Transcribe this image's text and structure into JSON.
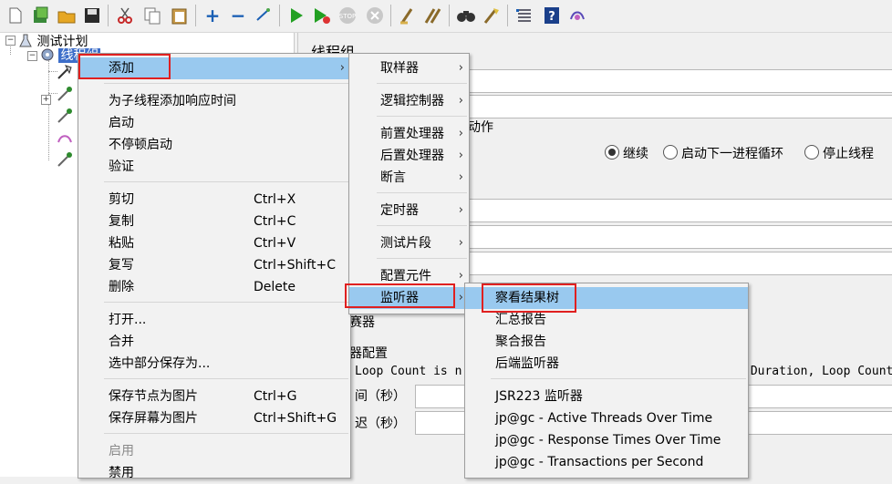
{
  "tree": {
    "root_label": "测试计划",
    "thread_group_label": "线程组"
  },
  "right_panel": {
    "title": "线程组",
    "action_label_fragment": "动作",
    "radio_continue": "继续",
    "radio_next_loop": "启动下一进程循环",
    "radio_stop_thread": "停止线程",
    "label_fragment_1": "赛器",
    "scheduler_fragment": "器配置",
    "loop_count_fragment": "Loop Count is n",
    "duration_fragment": "(Duration, Loop Count",
    "duration_label_fragment": "间（秒）",
    "delay_label_fragment": "迟（秒）"
  },
  "context_menu": {
    "items": [
      {
        "label": "添加",
        "shortcut": "",
        "submenu": true
      },
      {
        "label": "为子线程添加响应时间",
        "shortcut": ""
      },
      {
        "label": "启动",
        "shortcut": ""
      },
      {
        "label": "不停顿启动",
        "shortcut": ""
      },
      {
        "label": "验证",
        "shortcut": ""
      },
      {
        "label": "剪切",
        "shortcut": "Ctrl+X"
      },
      {
        "label": "复制",
        "shortcut": "Ctrl+C"
      },
      {
        "label": "粘贴",
        "shortcut": "Ctrl+V"
      },
      {
        "label": "复写",
        "shortcut": "Ctrl+Shift+C"
      },
      {
        "label": "删除",
        "shortcut": "Delete"
      },
      {
        "label": "打开...",
        "shortcut": ""
      },
      {
        "label": "合并",
        "shortcut": ""
      },
      {
        "label": "选中部分保存为...",
        "shortcut": ""
      },
      {
        "label": "保存节点为图片",
        "shortcut": "Ctrl+G"
      },
      {
        "label": "保存屏幕为图片",
        "shortcut": "Ctrl+Shift+G"
      },
      {
        "label": "启用",
        "shortcut": "",
        "disabled": true
      },
      {
        "label": "禁用",
        "shortcut": ""
      }
    ]
  },
  "add_submenu": {
    "items": [
      {
        "label": "取样器"
      },
      {
        "label": "逻辑控制器"
      },
      {
        "label": "前置处理器"
      },
      {
        "label": "后置处理器"
      },
      {
        "label": "断言"
      },
      {
        "label": "定时器"
      },
      {
        "label": "测试片段"
      },
      {
        "label": "配置元件"
      },
      {
        "label": "监听器"
      }
    ]
  },
  "listener_submenu": {
    "items": [
      {
        "label": "察看结果树"
      },
      {
        "label": "汇总报告"
      },
      {
        "label": "聚合报告"
      },
      {
        "label": "后端监听器"
      },
      {
        "label": "JSR223 监听器"
      },
      {
        "label": "jp@gc - Active Threads Over Time"
      },
      {
        "label": "jp@gc - Response Times Over Time"
      },
      {
        "label": "jp@gc - Transactions per Second"
      }
    ]
  },
  "colors": {
    "highlight": "#99c9ef",
    "annotation_box": "#e02020",
    "selected_tree_node": "#3d6ec9"
  }
}
